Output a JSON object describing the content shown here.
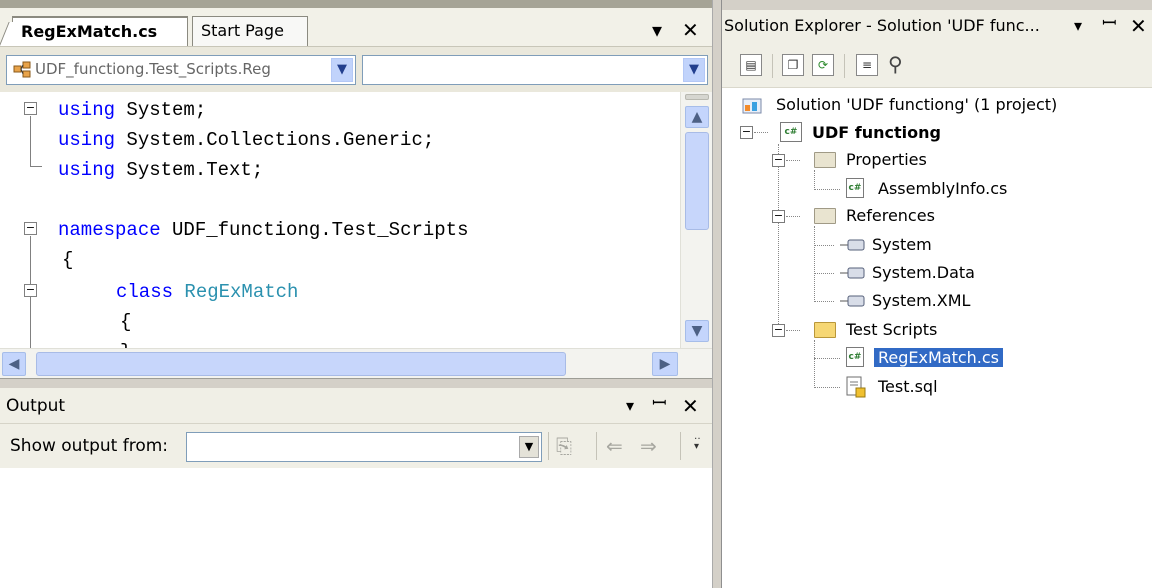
{
  "editor": {
    "tabs": [
      {
        "label": "RegExMatch.cs",
        "active": true
      },
      {
        "label": "Start Page",
        "active": false
      }
    ],
    "type_combo_value": "UDF_functiong.Test_Scripts.Reg",
    "member_combo_value": "",
    "code_lines": [
      {
        "kw": "using",
        "rest": " System;"
      },
      {
        "kw": "using",
        "rest": " System.Collections.Generic;"
      },
      {
        "kw": "using",
        "rest": " System.Text;"
      },
      {
        "kw": "",
        "rest": ""
      },
      {
        "kw": "namespace",
        "rest": " UDF_functiong.Test_Scripts"
      },
      {
        "kw": "",
        "rest": "{"
      },
      {
        "kw": "class",
        "type": "RegExMatch",
        "rest": ""
      },
      {
        "kw": "",
        "rest": "{"
      },
      {
        "kw": "",
        "rest": "}"
      }
    ]
  },
  "output": {
    "title": "Output",
    "show_output_label": "Show output from:",
    "show_output_value": ""
  },
  "solution_explorer": {
    "title": "Solution Explorer - Solution 'UDF func...",
    "tree": {
      "solution": "Solution 'UDF functiong' (1 project)",
      "project": "UDF functiong",
      "properties": "Properties",
      "assembly_info": "AssemblyInfo.cs",
      "references": "References",
      "ref_items": [
        "System",
        "System.Data",
        "System.XML"
      ],
      "test_scripts": "Test Scripts",
      "selected_file": "RegExMatch.cs",
      "other_file": "Test.sql"
    }
  },
  "colors": {
    "keyword": "#0000ff",
    "type": "#2b91af",
    "selection": "#316ac5"
  },
  "icons": {
    "dropdown": "▾",
    "close": "✕",
    "pin": "ꟷ"
  }
}
